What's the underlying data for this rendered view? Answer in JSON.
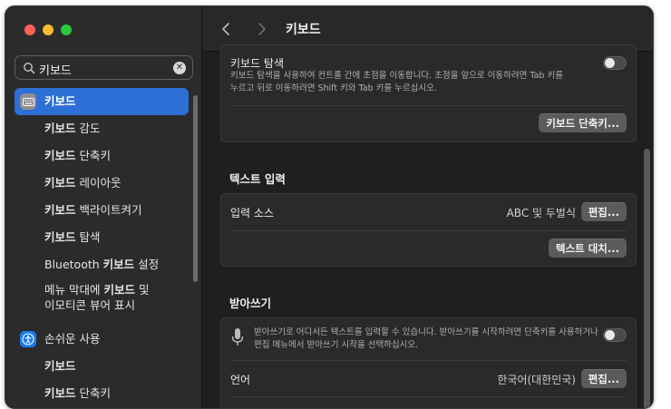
{
  "window": {
    "title": "키보드"
  },
  "search": {
    "value": "키보드"
  },
  "sidebar": {
    "items": [
      {
        "prefix": "",
        "bold": "키보드",
        "suffix": "",
        "selected": true
      },
      {
        "prefix": "",
        "bold": "키보드",
        "suffix": " 감도"
      },
      {
        "prefix": "",
        "bold": "키보드",
        "suffix": " 단축키"
      },
      {
        "prefix": "",
        "bold": "키보드",
        "suffix": " 레이아웃"
      },
      {
        "prefix": "",
        "bold": "키보드",
        "suffix": " 백라이트켜기"
      },
      {
        "prefix": "",
        "bold": "키보드",
        "suffix": " 탐색"
      },
      {
        "prefix": "Bluetooth ",
        "bold": "키보드",
        "suffix": " 설정"
      },
      {
        "line1_prefix": "메뉴 막대에 ",
        "line1_bold": "키보드",
        "line1_suffix": " 및",
        "line2": "이모티콘 뷰어 표시"
      }
    ],
    "accessibility": {
      "label": "손쉬운 사용",
      "items": [
        {
          "bold": "키보드",
          "suffix": ""
        },
        {
          "bold": "키보드",
          "suffix": " 단축키"
        }
      ]
    }
  },
  "main": {
    "keyboard_nav": {
      "title": "키보드 탐색",
      "description_line1": "키보드 탐색을 사용하여 컨트롤 간에 초점을 이동합니다. 초점을 앞으로 이동하려면 Tab 키를",
      "description_line2": "누르고 뒤로 이동하려면 Shift 키와 Tab 키를 누르십시오.",
      "shortcuts_button": "키보드 단축키..."
    },
    "text_input": {
      "section_title": "텍스트 입력",
      "input_sources_label": "입력 소스",
      "input_sources_value": "ABC 및 두벌식",
      "edit_button": "편집...",
      "replace_button": "텍스트 대치..."
    },
    "dictation": {
      "section_title": "받아쓰기",
      "description_line1": "받아쓰기로 어디서든 텍스트를 입력할 수 있습니다. 받아쓰기를 시작하려면 단축키를 사용하거나",
      "description_line2": "편집 메뉴에서 받아쓰기 시작을 선택하십시오.",
      "language_label": "언어",
      "language_value": "한국어(대한민국)",
      "edit_button": "편집..."
    }
  },
  "colors": {
    "accent": "#2d6fd4",
    "background": "#1f1f1f",
    "sidebar": "#2b2b2c"
  }
}
